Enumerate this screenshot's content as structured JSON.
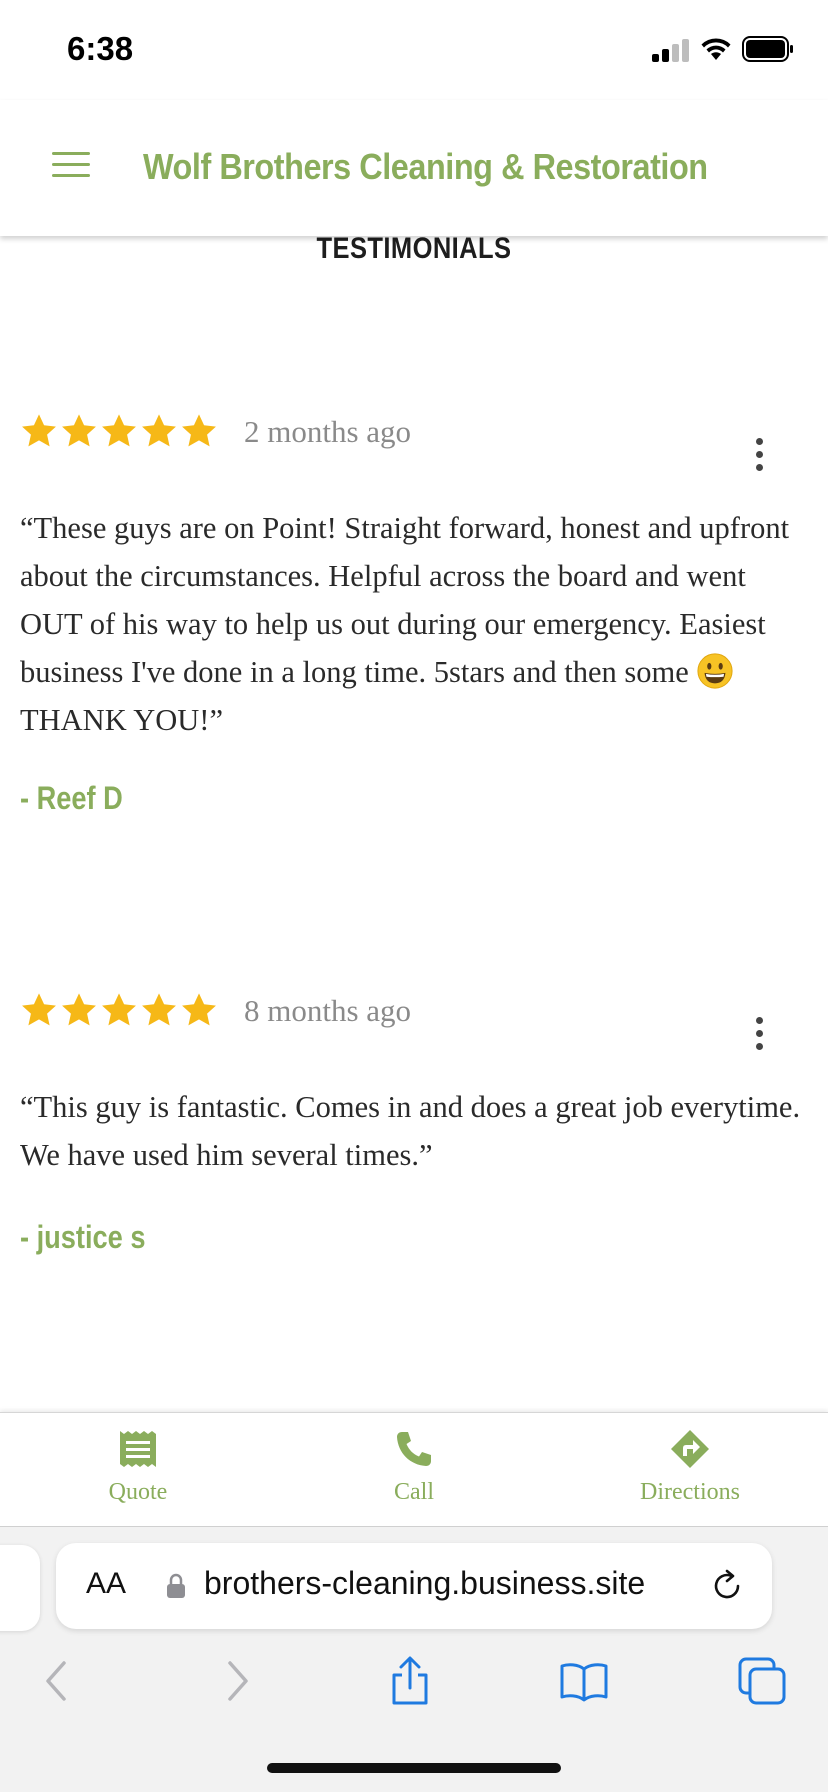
{
  "status_bar": {
    "time": "6:38"
  },
  "header": {
    "title": "Wolf Brothers Cleaning & Restoration"
  },
  "section": {
    "heading": "TESTIMONIALS"
  },
  "reviews": [
    {
      "rating": 5,
      "time_ago": "2 months ago",
      "text_before_emoji": "“These guys are on Point! Straight forward, honest and upfront about the circumstances. Helpful across the board and went OUT of his way to help us out during our emergency. Easiest business I've done in a long time. 5stars and then some",
      "text_after_emoji": " THANK YOU!”",
      "author": "- Reef D"
    },
    {
      "rating": 5,
      "time_ago": "8 months ago",
      "text": "“This guy is fantastic. Comes in and does a great job everytime. We have used him several times.”",
      "author": "- justice s"
    }
  ],
  "action_bar": {
    "quote_label": "Quote",
    "call_label": "Call",
    "directions_label": "Directions"
  },
  "browser": {
    "aa_label": "AA",
    "url": "brothers-cleaning.business.site"
  },
  "colors": {
    "brand_green": "#8aad5c",
    "star_yellow": "#f6b817",
    "ios_blue": "#1f7ae0"
  }
}
